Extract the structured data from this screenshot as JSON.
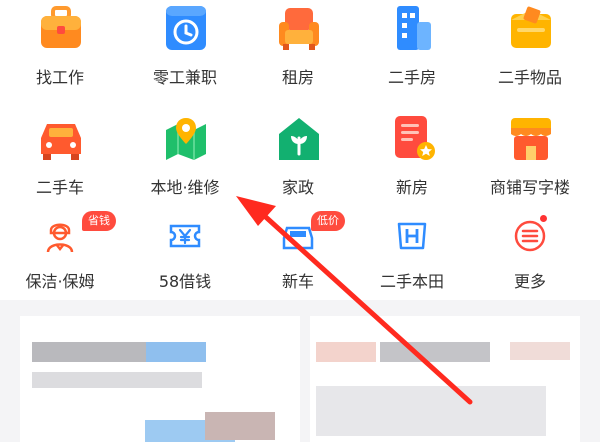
{
  "row1": [
    {
      "label": "找工作",
      "icon": "briefcase-icon"
    },
    {
      "label": "零工兼职",
      "icon": "clock-icon"
    },
    {
      "label": "租房",
      "icon": "sofa-icon"
    },
    {
      "label": "二手房",
      "icon": "building-icon"
    },
    {
      "label": "二手物品",
      "icon": "box-icon"
    }
  ],
  "row2": [
    {
      "label": "二手车",
      "icon": "car-icon"
    },
    {
      "label": "本地·维修",
      "icon": "map-pin-icon"
    },
    {
      "label": "家政",
      "icon": "house-plant-icon"
    },
    {
      "label": "新房",
      "icon": "document-star-icon"
    },
    {
      "label": "商铺写字楼",
      "icon": "shop-icon"
    }
  ],
  "row3": [
    {
      "label": "保洁·保姆",
      "icon": "housekeeper-icon",
      "badge": "省钱"
    },
    {
      "label": "58借钱",
      "icon": "yuan-ticket-icon"
    },
    {
      "label": "新车",
      "icon": "new-car-icon",
      "badge": "低价"
    },
    {
      "label": "二手本田",
      "icon": "honda-icon"
    },
    {
      "label": "更多",
      "icon": "more-menu-icon",
      "dot": true
    }
  ],
  "colors": {
    "accent_red": "#ff4b3e",
    "orange": "#ff8a1f",
    "blue": "#2f8cff",
    "green": "#1fbf6b",
    "yellow": "#ffb400"
  }
}
